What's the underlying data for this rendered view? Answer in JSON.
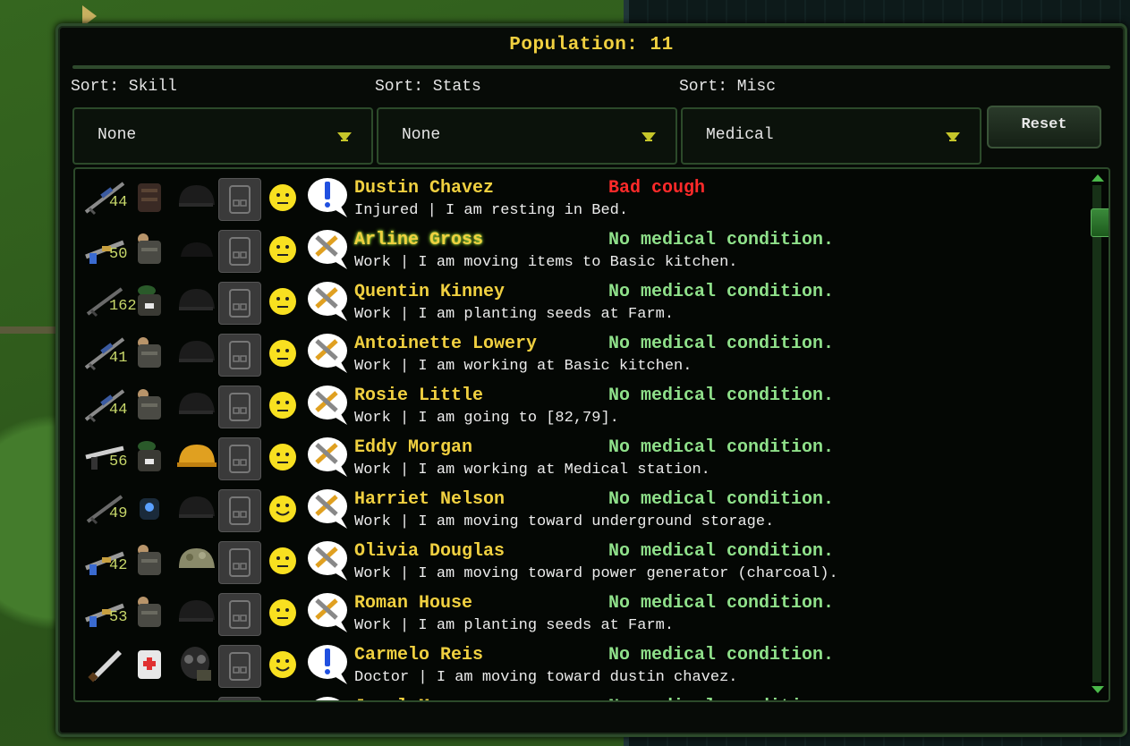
{
  "window": {
    "title": "Population: 11"
  },
  "sort": {
    "skill": {
      "label": "Sort: Skill",
      "selected": "None"
    },
    "stats": {
      "label": "Sort: Stats",
      "selected": "None"
    },
    "misc": {
      "label": "Sort: Misc",
      "selected": "Medical"
    },
    "reset_label": "Reset"
  },
  "colonists": [
    {
      "name": "Dustin Chavez",
      "condition": "Bad cough",
      "condition_bad": true,
      "status": "Injured | I am resting in Bed.",
      "weapon_icon": "sniper-rifle-icon",
      "weapon_count": "44",
      "armor_icon": "vest-icon",
      "helmet_icon": "black-helmet-icon",
      "mood_icon": "neutral-face-icon",
      "bubble_icon": "exclamation-bubble-icon"
    },
    {
      "name": "Arline Gross",
      "condition": "No medical condition.",
      "condition_bad": false,
      "status": "Work | I am moving items to Basic kitchen.",
      "weapon_icon": "assault-rifle-icon",
      "weapon_count": "50",
      "armor_icon": "tactical-vest-icon",
      "helmet_icon": "black-cap-icon",
      "mood_icon": "neutral-face-icon",
      "bubble_icon": "tools-bubble-icon",
      "selected": true
    },
    {
      "name": "Quentin Kinney",
      "condition": "No medical condition.",
      "condition_bad": false,
      "status": "Work | I am planting seeds at Farm.",
      "weapon_icon": "rifle-icon",
      "weapon_count": "162",
      "armor_icon": "green-vest-icon",
      "helmet_icon": "black-helmet-icon",
      "mood_icon": "neutral-face-icon",
      "bubble_icon": "tools-bubble-icon"
    },
    {
      "name": "Antoinette Lowery",
      "condition": "No medical condition.",
      "condition_bad": false,
      "status": "Work | I am working at Basic kitchen.",
      "weapon_icon": "sniper-rifle-icon",
      "weapon_count": "41",
      "armor_icon": "tactical-vest-icon",
      "helmet_icon": "black-helmet-icon",
      "mood_icon": "neutral-face-icon",
      "bubble_icon": "tools-bubble-icon"
    },
    {
      "name": "Rosie Little",
      "condition": "No medical condition.",
      "condition_bad": false,
      "status": "Work | I am going to [82,79].",
      "weapon_icon": "sniper-rifle-icon",
      "weapon_count": "44",
      "armor_icon": "tactical-vest-icon",
      "helmet_icon": "black-helmet-icon",
      "mood_icon": "neutral-face-icon",
      "bubble_icon": "tools-bubble-icon"
    },
    {
      "name": "Eddy Morgan",
      "condition": "No medical condition.",
      "condition_bad": false,
      "status": "Work | I am working at Medical station.",
      "weapon_icon": "shotgun-icon",
      "weapon_count": "56",
      "armor_icon": "green-vest-icon",
      "helmet_icon": "hard-hat-icon",
      "mood_icon": "neutral-face-icon",
      "bubble_icon": "tools-bubble-icon"
    },
    {
      "name": "Harriet Nelson",
      "condition": "No medical condition.",
      "condition_bad": false,
      "status": "Work | I am moving toward underground storage.",
      "weapon_icon": "rifle-icon",
      "weapon_count": "49",
      "armor_icon": "blue-vest-icon",
      "helmet_icon": "black-helmet-icon",
      "mood_icon": "happy-face-icon",
      "bubble_icon": "tools-bubble-icon"
    },
    {
      "name": "Olivia Douglas",
      "condition": "No medical condition.",
      "condition_bad": false,
      "status": "Work | I am moving toward power generator (charcoal).",
      "weapon_icon": "assault-rifle-icon",
      "weapon_count": "42",
      "armor_icon": "tactical-vest-icon",
      "helmet_icon": "camo-helmet-icon",
      "mood_icon": "neutral-face-icon",
      "bubble_icon": "tools-bubble-icon"
    },
    {
      "name": "Roman House",
      "condition": "No medical condition.",
      "condition_bad": false,
      "status": "Work | I am planting seeds at Farm.",
      "weapon_icon": "assault-rifle-icon",
      "weapon_count": "53",
      "armor_icon": "tactical-vest-icon",
      "helmet_icon": "black-helmet-icon",
      "mood_icon": "neutral-face-icon",
      "bubble_icon": "tools-bubble-icon"
    },
    {
      "name": "Carmelo Reis",
      "condition": "No medical condition.",
      "condition_bad": false,
      "status": "Doctor | I am moving toward dustin chavez.",
      "weapon_icon": "knife-icon",
      "weapon_count": "",
      "armor_icon": "medic-coat-icon",
      "helmet_icon": "gas-mask-icon",
      "mood_icon": "happy-face-icon",
      "bubble_icon": "exclamation-bubble-icon"
    },
    {
      "name": "Jewel Moon",
      "condition": "No medical condition.",
      "condition_bad": false,
      "status": "",
      "weapon_icon": "rifle-icon",
      "weapon_count": "",
      "armor_icon": "vest-icon",
      "helmet_icon": "black-helmet-icon",
      "mood_icon": "neutral-face-icon",
      "bubble_icon": "exclamation-bubble-icon"
    }
  ],
  "colors": {
    "title": "#f0d040",
    "name": "#f0d040",
    "condition_ok": "#8fe08a",
    "condition_bad": "#ff2a2a",
    "panel_border": "#2c4a2a"
  }
}
